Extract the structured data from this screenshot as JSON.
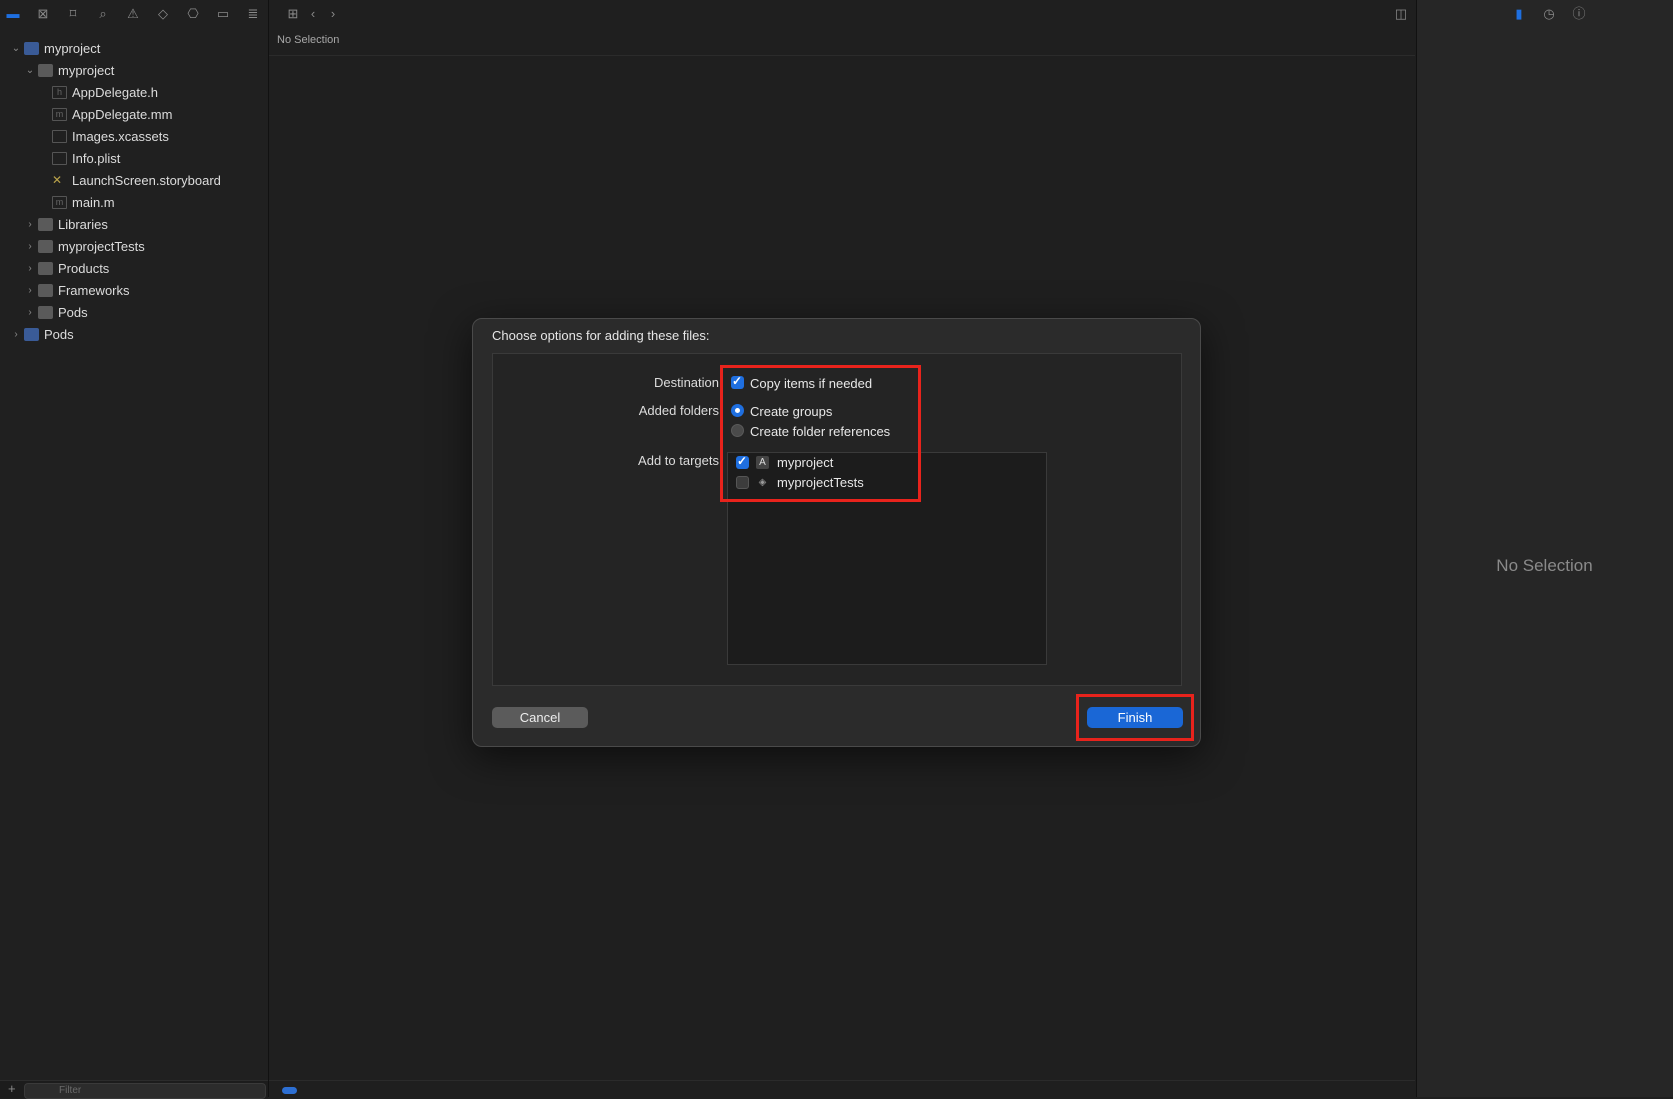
{
  "navigator": {
    "tree": [
      {
        "label": "myproject",
        "kind": "project",
        "disclosure": "open",
        "level": 0
      },
      {
        "label": "myproject",
        "kind": "folder",
        "disclosure": "open",
        "level": 1
      },
      {
        "label": "AppDelegate.h",
        "kind": "h-file",
        "level": 2
      },
      {
        "label": "AppDelegate.mm",
        "kind": "m-file",
        "level": 2
      },
      {
        "label": "Images.xcassets",
        "kind": "assets",
        "level": 2
      },
      {
        "label": "Info.plist",
        "kind": "plist",
        "level": 2
      },
      {
        "label": "LaunchScreen.storyboard",
        "kind": "storyboard",
        "level": 2
      },
      {
        "label": "main.m",
        "kind": "m-file",
        "level": 2
      },
      {
        "label": "Libraries",
        "kind": "folder",
        "disclosure": "closed",
        "level": 1
      },
      {
        "label": "myprojectTests",
        "kind": "folder",
        "disclosure": "closed",
        "level": 1
      },
      {
        "label": "Products",
        "kind": "folder",
        "disclosure": "closed",
        "level": 1
      },
      {
        "label": "Frameworks",
        "kind": "folder",
        "disclosure": "closed",
        "level": 1
      },
      {
        "label": "Pods",
        "kind": "folder",
        "disclosure": "closed",
        "level": 1
      },
      {
        "label": "Pods",
        "kind": "project",
        "disclosure": "closed",
        "level": 0
      }
    ],
    "filter_placeholder": "Filter"
  },
  "editor": {
    "jump_bar_text": "No Selection"
  },
  "inspector": {
    "empty_text": "No Selection"
  },
  "dialog": {
    "title": "Choose options for adding these files:",
    "destination_label": "Destination",
    "copy_items_label": "Copy items if needed",
    "copy_items_checked": true,
    "added_folders_label": "Added folders",
    "create_groups_label": "Create groups",
    "create_groups_selected": true,
    "create_folder_refs_label": "Create folder references",
    "create_folder_refs_selected": false,
    "add_to_targets_label": "Add to targets",
    "targets": [
      {
        "name": "myproject",
        "checked": true,
        "icon": "app-target-icon"
      },
      {
        "name": "myprojectTests",
        "checked": false,
        "icon": "test-target-icon"
      }
    ],
    "cancel_label": "Cancel",
    "finish_label": "Finish"
  },
  "colors": {
    "accent": "#1f6fe0",
    "highlight": "#e8231c",
    "background": "#1f1f1f"
  }
}
